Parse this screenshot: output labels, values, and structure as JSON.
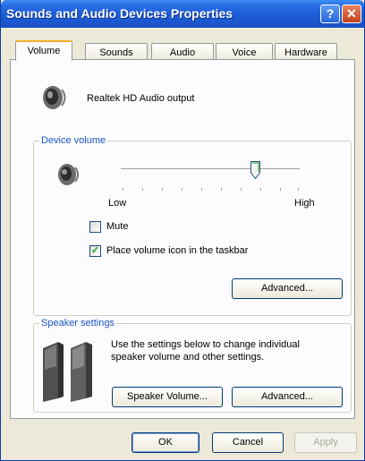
{
  "window": {
    "title": "Sounds and Audio Devices Properties",
    "help_label": "?",
    "close_label": "✕"
  },
  "tabs": [
    {
      "label": "Volume",
      "active": true
    },
    {
      "label": "Sounds",
      "active": false
    },
    {
      "label": "Audio",
      "active": false
    },
    {
      "label": "Voice",
      "active": false
    },
    {
      "label": "Hardware",
      "active": false
    }
  ],
  "device": {
    "name": "Realtek HD Audio output"
  },
  "device_volume": {
    "group_label": "Device volume",
    "low_label": "Low",
    "high_label": "High",
    "level": 0.75,
    "mute_label": "Mute",
    "mute_checked": false,
    "taskbar_label": "Place volume icon in the taskbar",
    "taskbar_checked": true,
    "advanced_label": "Advanced..."
  },
  "speaker_settings": {
    "group_label": "Speaker settings",
    "description": "Use the settings below to change individual speaker volume and other settings.",
    "speaker_volume_label": "Speaker Volume...",
    "advanced_label": "Advanced..."
  },
  "footer": {
    "ok_label": "OK",
    "cancel_label": "Cancel",
    "apply_label": "Apply"
  },
  "colors": {
    "title_bar": "#1f5fd8",
    "group_label": "#1a52c4",
    "active_tab_accent": "#f2ad2c"
  }
}
